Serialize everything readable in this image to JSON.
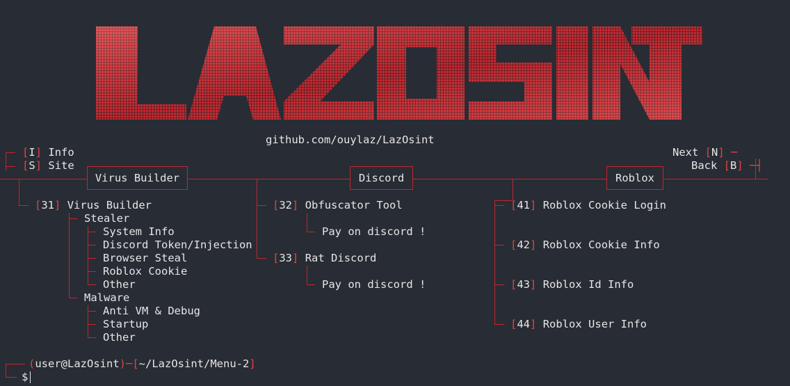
{
  "logo_text": "LAZOSINT",
  "github": "github.com/ouylaz/LazOsint",
  "left_nav": [
    {
      "key": "I",
      "label": "Info"
    },
    {
      "key": "S",
      "label": "Site"
    }
  ],
  "right_nav": [
    {
      "label": "Next",
      "key": "N"
    },
    {
      "label": "Back",
      "key": "B"
    }
  ],
  "sections": {
    "virus_builder": {
      "title": "Virus Builder",
      "option": {
        "num": "31",
        "label": "Virus Builder"
      },
      "stealer": "Stealer",
      "stealer_items": [
        "System Info",
        "Discord Token/Injection",
        "Browser Steal",
        "Roblox Cookie",
        "Other"
      ],
      "malware": "Malware",
      "malware_items": [
        "Anti VM & Debug",
        "Startup",
        "Other"
      ]
    },
    "discord": {
      "title": "Discord",
      "options": [
        {
          "num": "32",
          "label": "Obfuscator Tool",
          "note": "Pay on discord !"
        },
        {
          "num": "33",
          "label": "Rat Discord",
          "note": "Pay on discord !"
        }
      ]
    },
    "roblox": {
      "title": "Roblox",
      "options": [
        {
          "num": "41",
          "label": "Roblox Cookie Login"
        },
        {
          "num": "42",
          "label": "Roblox Cookie Info"
        },
        {
          "num": "43",
          "label": "Roblox Id Info"
        },
        {
          "num": "44",
          "label": "Roblox User Info"
        }
      ]
    }
  },
  "prompt": {
    "user": "user@LazOsint",
    "path": "~/LazOsint/Menu-2",
    "symbol": "$"
  },
  "colors": {
    "accent": "#e0463f",
    "line": "#c3262f",
    "background": "#282c34",
    "text": "#e6e6e6"
  }
}
